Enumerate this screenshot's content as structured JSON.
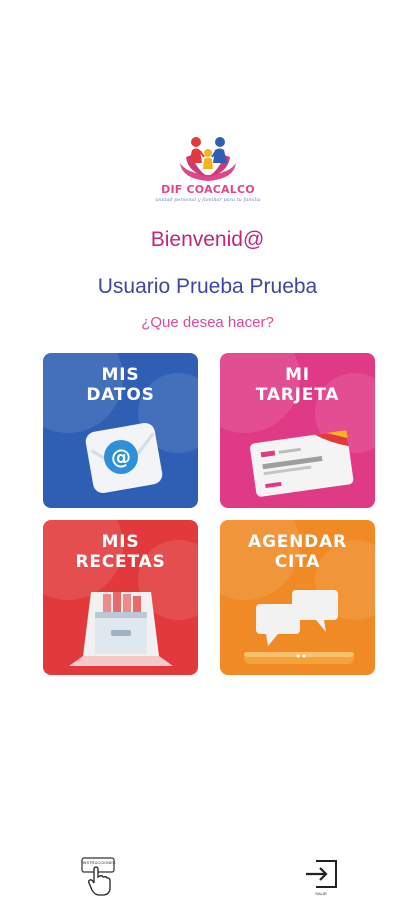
{
  "logo": {
    "name": "DIF COACALCO",
    "tagline": "unidad personal y familiar para tu familia"
  },
  "greeting": {
    "welcome": "Bienvenid@",
    "user_name": "Usuario Prueba Prueba",
    "question": "¿Que desea hacer?"
  },
  "tiles": [
    {
      "line1": "MIS",
      "line2": "DATOS",
      "icon": "email-at-icon"
    },
    {
      "line1": "MI",
      "line2": "TARJETA",
      "icon": "family-card-icon"
    },
    {
      "line1": "MIS",
      "line2": "RECETAS",
      "icon": "file-drawer-icon"
    },
    {
      "line1": "AGENDAR",
      "line2": "CITA",
      "icon": "chat-bubbles-icon"
    }
  ],
  "bottom": {
    "instructions_label": "INSTRUCCIONES",
    "logout_label": "SALIR"
  },
  "colors": {
    "datos": "#2f5fb4",
    "tarjeta": "#e03a86",
    "recetas": "#e23a3c",
    "cita": "#ef8a24"
  }
}
